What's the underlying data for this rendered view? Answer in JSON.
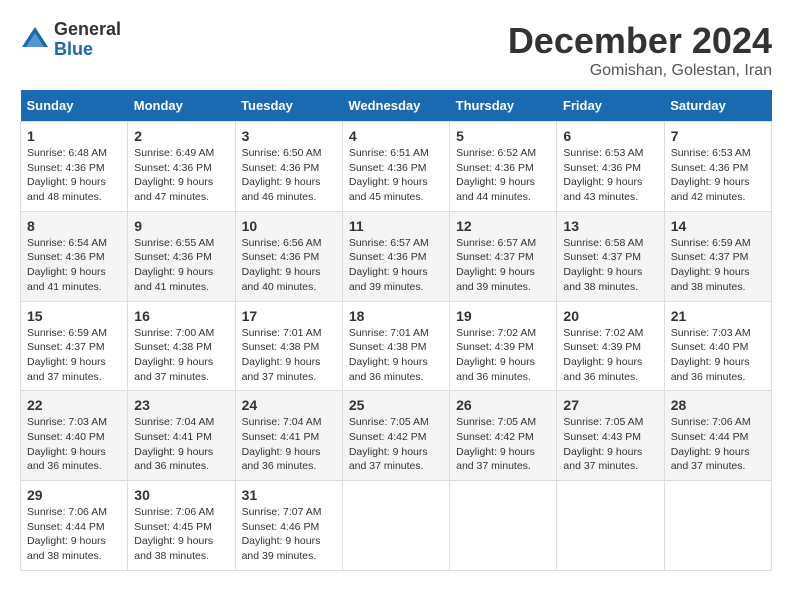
{
  "logo": {
    "general": "General",
    "blue": "Blue"
  },
  "title": {
    "month_year": "December 2024",
    "location": "Gomishan, Golestan, Iran"
  },
  "weekdays": [
    "Sunday",
    "Monday",
    "Tuesday",
    "Wednesday",
    "Thursday",
    "Friday",
    "Saturday"
  ],
  "weeks": [
    [
      {
        "day": "1",
        "sunrise": "6:48 AM",
        "sunset": "4:36 PM",
        "daylight": "9 hours and 48 minutes."
      },
      {
        "day": "2",
        "sunrise": "6:49 AM",
        "sunset": "4:36 PM",
        "daylight": "9 hours and 47 minutes."
      },
      {
        "day": "3",
        "sunrise": "6:50 AM",
        "sunset": "4:36 PM",
        "daylight": "9 hours and 46 minutes."
      },
      {
        "day": "4",
        "sunrise": "6:51 AM",
        "sunset": "4:36 PM",
        "daylight": "9 hours and 45 minutes."
      },
      {
        "day": "5",
        "sunrise": "6:52 AM",
        "sunset": "4:36 PM",
        "daylight": "9 hours and 44 minutes."
      },
      {
        "day": "6",
        "sunrise": "6:53 AM",
        "sunset": "4:36 PM",
        "daylight": "9 hours and 43 minutes."
      },
      {
        "day": "7",
        "sunrise": "6:53 AM",
        "sunset": "4:36 PM",
        "daylight": "9 hours and 42 minutes."
      }
    ],
    [
      {
        "day": "8",
        "sunrise": "6:54 AM",
        "sunset": "4:36 PM",
        "daylight": "9 hours and 41 minutes."
      },
      {
        "day": "9",
        "sunrise": "6:55 AM",
        "sunset": "4:36 PM",
        "daylight": "9 hours and 41 minutes."
      },
      {
        "day": "10",
        "sunrise": "6:56 AM",
        "sunset": "4:36 PM",
        "daylight": "9 hours and 40 minutes."
      },
      {
        "day": "11",
        "sunrise": "6:57 AM",
        "sunset": "4:36 PM",
        "daylight": "9 hours and 39 minutes."
      },
      {
        "day": "12",
        "sunrise": "6:57 AM",
        "sunset": "4:37 PM",
        "daylight": "9 hours and 39 minutes."
      },
      {
        "day": "13",
        "sunrise": "6:58 AM",
        "sunset": "4:37 PM",
        "daylight": "9 hours and 38 minutes."
      },
      {
        "day": "14",
        "sunrise": "6:59 AM",
        "sunset": "4:37 PM",
        "daylight": "9 hours and 38 minutes."
      }
    ],
    [
      {
        "day": "15",
        "sunrise": "6:59 AM",
        "sunset": "4:37 PM",
        "daylight": "9 hours and 37 minutes."
      },
      {
        "day": "16",
        "sunrise": "7:00 AM",
        "sunset": "4:38 PM",
        "daylight": "9 hours and 37 minutes."
      },
      {
        "day": "17",
        "sunrise": "7:01 AM",
        "sunset": "4:38 PM",
        "daylight": "9 hours and 37 minutes."
      },
      {
        "day": "18",
        "sunrise": "7:01 AM",
        "sunset": "4:38 PM",
        "daylight": "9 hours and 36 minutes."
      },
      {
        "day": "19",
        "sunrise": "7:02 AM",
        "sunset": "4:39 PM",
        "daylight": "9 hours and 36 minutes."
      },
      {
        "day": "20",
        "sunrise": "7:02 AM",
        "sunset": "4:39 PM",
        "daylight": "9 hours and 36 minutes."
      },
      {
        "day": "21",
        "sunrise": "7:03 AM",
        "sunset": "4:40 PM",
        "daylight": "9 hours and 36 minutes."
      }
    ],
    [
      {
        "day": "22",
        "sunrise": "7:03 AM",
        "sunset": "4:40 PM",
        "daylight": "9 hours and 36 minutes."
      },
      {
        "day": "23",
        "sunrise": "7:04 AM",
        "sunset": "4:41 PM",
        "daylight": "9 hours and 36 minutes."
      },
      {
        "day": "24",
        "sunrise": "7:04 AM",
        "sunset": "4:41 PM",
        "daylight": "9 hours and 36 minutes."
      },
      {
        "day": "25",
        "sunrise": "7:05 AM",
        "sunset": "4:42 PM",
        "daylight": "9 hours and 37 minutes."
      },
      {
        "day": "26",
        "sunrise": "7:05 AM",
        "sunset": "4:42 PM",
        "daylight": "9 hours and 37 minutes."
      },
      {
        "day": "27",
        "sunrise": "7:05 AM",
        "sunset": "4:43 PM",
        "daylight": "9 hours and 37 minutes."
      },
      {
        "day": "28",
        "sunrise": "7:06 AM",
        "sunset": "4:44 PM",
        "daylight": "9 hours and 37 minutes."
      }
    ],
    [
      {
        "day": "29",
        "sunrise": "7:06 AM",
        "sunset": "4:44 PM",
        "daylight": "9 hours and 38 minutes."
      },
      {
        "day": "30",
        "sunrise": "7:06 AM",
        "sunset": "4:45 PM",
        "daylight": "9 hours and 38 minutes."
      },
      {
        "day": "31",
        "sunrise": "7:07 AM",
        "sunset": "4:46 PM",
        "daylight": "9 hours and 39 minutes."
      },
      null,
      null,
      null,
      null
    ]
  ]
}
